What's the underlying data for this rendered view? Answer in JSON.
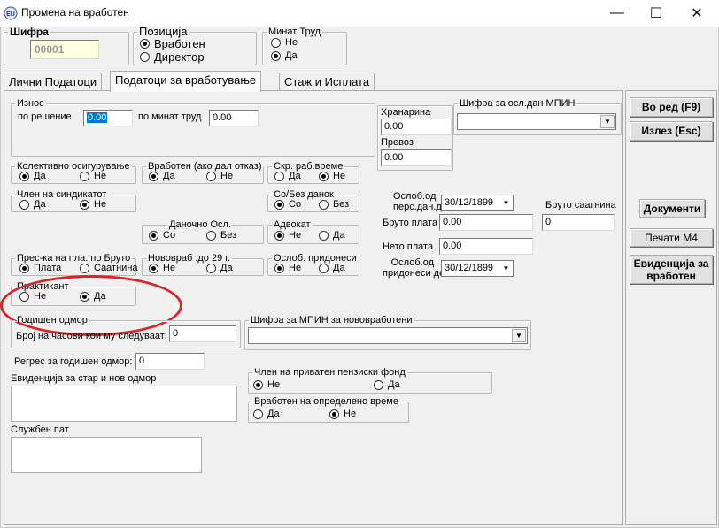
{
  "window": {
    "title": "Промена на вработен",
    "minimize": "—",
    "maximize": "☐",
    "close": "✕"
  },
  "header": {
    "sifra_label": "Шифра",
    "sifra_value": "00001",
    "pozicija_label": "Позиција",
    "pozicija_options": [
      "Вработен",
      "Директор"
    ],
    "pozicija_selected": 0,
    "minat_trud_label": "Минат Труд",
    "minat_trud_options": [
      "Не",
      "Да"
    ],
    "minat_trud_selected": 1
  },
  "tabs": [
    "Лични Податоци",
    "Податоци за вработување",
    "Стаж и Исплата"
  ],
  "active_tab": 1,
  "iznos": {
    "label": "Износ",
    "po_resenie_label": "по решение",
    "po_resenie_value": "0.00",
    "po_minat_trud_label": "по минат труд",
    "po_minat_trud_value": "0.00"
  },
  "hranarina": {
    "label": "Хранарина",
    "value": "0.00"
  },
  "prevoz": {
    "label": "Превоз",
    "value": "0.00"
  },
  "sifra_osl_mpin": {
    "label": "Шифра за осл.дан МПИН",
    "value": ""
  },
  "radio_groups": {
    "kolektivno": {
      "label": "Колективно осигурување",
      "options": [
        "Да",
        "Не"
      ],
      "selected": 0
    },
    "vraboten_otkaz": {
      "label": "Вработен (ако дал отказ)",
      "options": [
        "Да",
        "Не"
      ],
      "selected": 0
    },
    "skr_rab_vreme": {
      "label": "Скр. раб.време",
      "options": [
        "Да",
        "Не"
      ],
      "selected": 1
    },
    "clen_sindikat": {
      "label": "Член на синдикатот",
      "options": [
        "Да",
        "Не"
      ],
      "selected": 1
    },
    "so_bez_danok": {
      "label": "Со/Без данок",
      "options": [
        "Со",
        "Без"
      ],
      "selected": 0
    },
    "danocno_osl": {
      "label": "Даночно Осл.",
      "options": [
        "Со",
        "Без"
      ],
      "selected": 0
    },
    "advokat": {
      "label": "Адвокат",
      "options": [
        "Не",
        "Да"
      ],
      "selected": 0
    },
    "pres_ka": {
      "label": "Прес-ка на пла. по  Бруто",
      "options": [
        "Плата",
        "Саатнина"
      ],
      "selected": 0
    },
    "novovrab": {
      "label": "Нововраб .до 29 г.",
      "options": [
        "Не",
        "Да"
      ],
      "selected": 0
    },
    "osl_pridonesi": {
      "label": "Ослоб. придонеси",
      "options": [
        "Не",
        "Да"
      ],
      "selected": 0
    },
    "praktikant": {
      "label": "Практикант",
      "options": [
        "Не",
        "Да"
      ],
      "selected": 1
    },
    "privaten_fond": {
      "label": "Член на приватен пензиски фонд",
      "options": [
        "Не",
        "Да"
      ],
      "selected": 0
    },
    "opredeleno_vreme": {
      "label": "Вработен на определено време",
      "options": [
        "Да",
        "Не"
      ],
      "selected": 1
    }
  },
  "oslob_pers_dan": {
    "label_line1": "Ослоб.од",
    "label_line2": "перс.дан.до",
    "value": "30/12/1899"
  },
  "bruto_saatnina": {
    "label": "Бруто саатнина",
    "value": "0"
  },
  "bruto_plata": {
    "label": "Бруто плата",
    "value": "0.00"
  },
  "neto_plata": {
    "label": "Нето плата",
    "value": "0.00"
  },
  "oslob_pridonesi_do": {
    "label_line1": "Ослоб.од",
    "label_line2": "придонеси до",
    "value": "30/12/1899"
  },
  "godisen_odmor": {
    "label": "Годишен одмор",
    "casovi_label": "Број на часови кои му следуваат:",
    "casovi_value": "0"
  },
  "sifra_mpin_novovrab": {
    "label": "Шифра за МПИН за нововработени",
    "value": ""
  },
  "regres": {
    "label": "Регрес за годишен одмор:",
    "value": "0"
  },
  "evidencija_odmor": {
    "label": "Евиденција за стар и нов одмор"
  },
  "sluzben_pat": {
    "label": "Службен пат"
  },
  "buttons": {
    "vo_red": "Во ред (F9)",
    "izlez": "Излез (Esc)",
    "dokumenti": "Документи",
    "pecati": "Печати М4",
    "evidencija": "Евиденција за вработен"
  },
  "colors": {
    "highlight_ellipse": "#d6262a",
    "sifra_field_bg": "#ffffe1",
    "selection": "#0078d7"
  }
}
